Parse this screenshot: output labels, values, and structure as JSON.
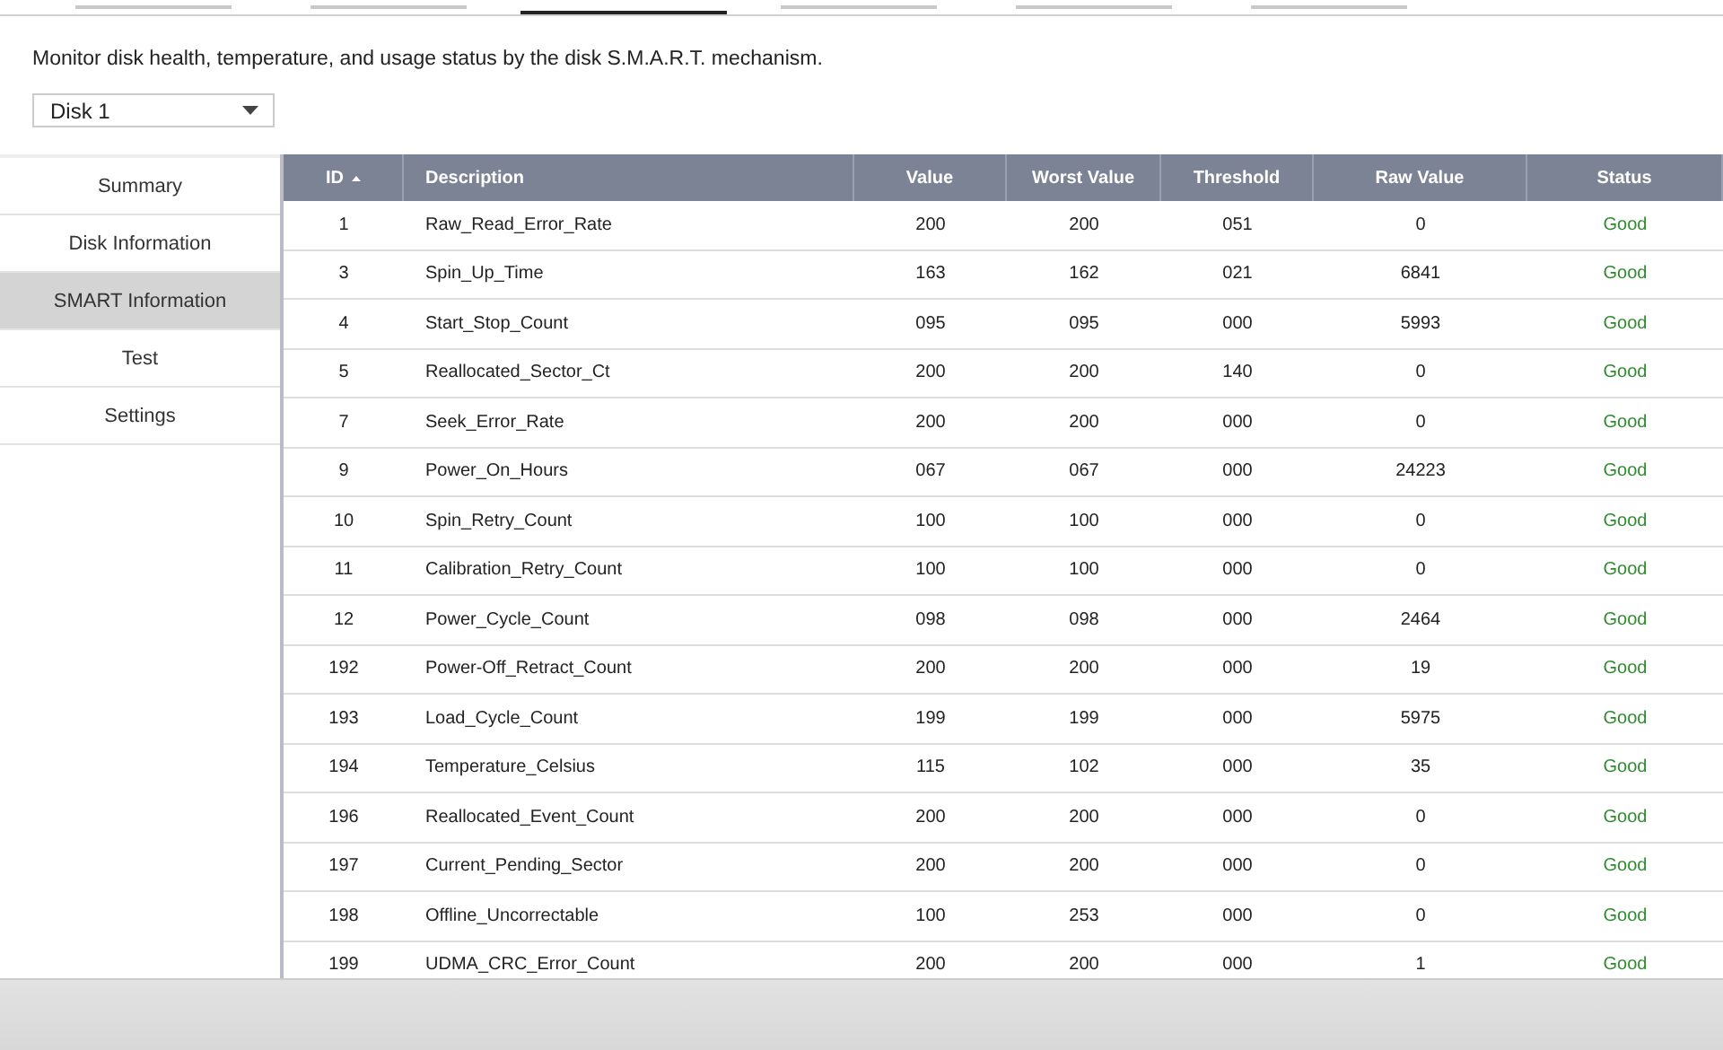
{
  "tabs": [
    {
      "selected": false
    },
    {
      "selected": false
    },
    {
      "selected": true
    },
    {
      "selected": false
    },
    {
      "selected": false
    },
    {
      "selected": false
    }
  ],
  "description": "Monitor disk health, temperature, and usage status by the disk S.M.A.R.T. mechanism.",
  "disk_select": {
    "value": "Disk 1"
  },
  "sidebar": {
    "items": [
      {
        "label": "Summary",
        "selected": false
      },
      {
        "label": "Disk Information",
        "selected": false
      },
      {
        "label": "SMART Information",
        "selected": true
      },
      {
        "label": "Test",
        "selected": false
      },
      {
        "label": "Settings",
        "selected": false
      }
    ]
  },
  "table": {
    "columns": [
      {
        "label": "ID",
        "sorted": true
      },
      {
        "label": "Description",
        "sorted": false
      },
      {
        "label": "Value",
        "sorted": false
      },
      {
        "label": "Worst Value",
        "sorted": false
      },
      {
        "label": "Threshold",
        "sorted": false
      },
      {
        "label": "Raw Value",
        "sorted": false
      },
      {
        "label": "Status",
        "sorted": false
      }
    ],
    "rows": [
      [
        "1",
        "Raw_Read_Error_Rate",
        "200",
        "200",
        "051",
        "0",
        "Good"
      ],
      [
        "3",
        "Spin_Up_Time",
        "163",
        "162",
        "021",
        "6841",
        "Good"
      ],
      [
        "4",
        "Start_Stop_Count",
        "095",
        "095",
        "000",
        "5993",
        "Good"
      ],
      [
        "5",
        "Reallocated_Sector_Ct",
        "200",
        "200",
        "140",
        "0",
        "Good"
      ],
      [
        "7",
        "Seek_Error_Rate",
        "200",
        "200",
        "000",
        "0",
        "Good"
      ],
      [
        "9",
        "Power_On_Hours",
        "067",
        "067",
        "000",
        "24223",
        "Good"
      ],
      [
        "10",
        "Spin_Retry_Count",
        "100",
        "100",
        "000",
        "0",
        "Good"
      ],
      [
        "11",
        "Calibration_Retry_Count",
        "100",
        "100",
        "000",
        "0",
        "Good"
      ],
      [
        "12",
        "Power_Cycle_Count",
        "098",
        "098",
        "000",
        "2464",
        "Good"
      ],
      [
        "192",
        "Power-Off_Retract_Count",
        "200",
        "200",
        "000",
        "19",
        "Good"
      ],
      [
        "193",
        "Load_Cycle_Count",
        "199",
        "199",
        "000",
        "5975",
        "Good"
      ],
      [
        "194",
        "Temperature_Celsius",
        "115",
        "102",
        "000",
        "35",
        "Good"
      ],
      [
        "196",
        "Reallocated_Event_Count",
        "200",
        "200",
        "000",
        "0",
        "Good"
      ],
      [
        "197",
        "Current_Pending_Sector",
        "200",
        "200",
        "000",
        "0",
        "Good"
      ],
      [
        "198",
        "Offline_Uncorrectable",
        "100",
        "253",
        "000",
        "0",
        "Good"
      ],
      [
        "199",
        "UDMA_CRC_Error_Count",
        "200",
        "200",
        "000",
        "1",
        "Good"
      ]
    ]
  }
}
